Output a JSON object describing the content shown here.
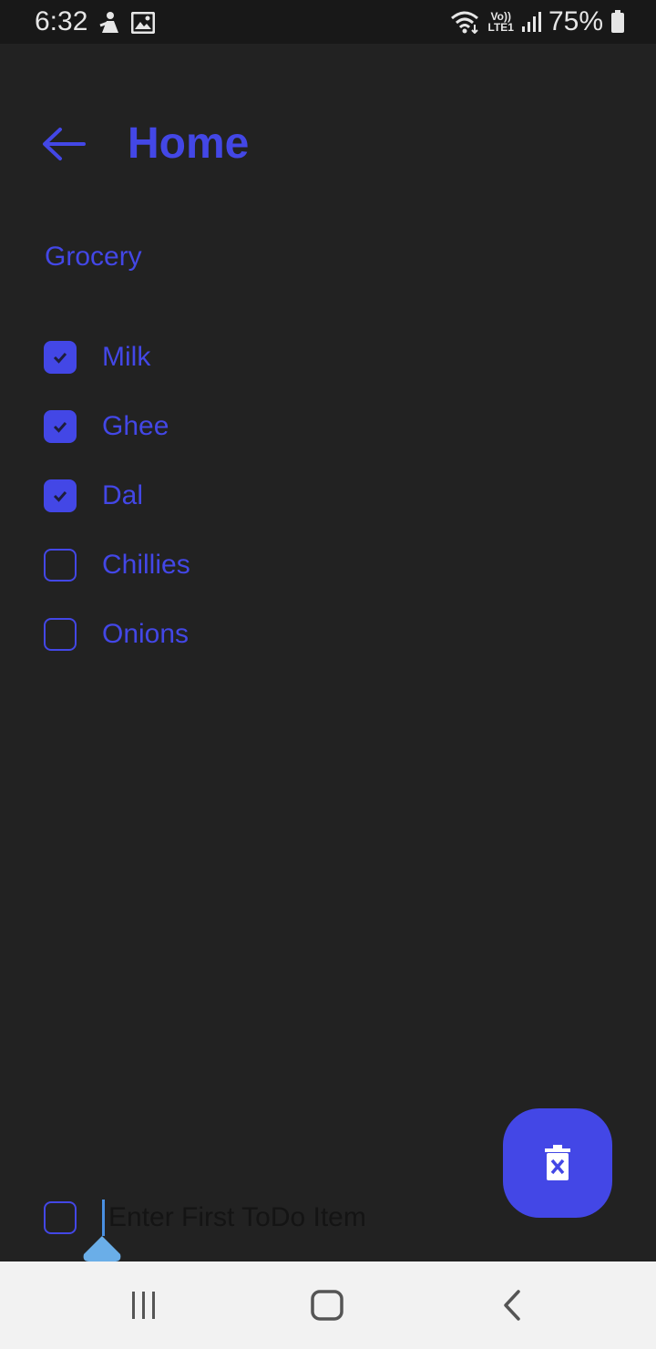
{
  "status_bar": {
    "time": "6:32",
    "battery": "75%",
    "network_label_top": "Vo))",
    "network_label_bottom": "LTE1",
    "icons": [
      "notification-app-icon",
      "image-icon",
      "wifi-icon",
      "signal-icon",
      "battery-icon"
    ]
  },
  "header": {
    "title": "Home",
    "back_icon": "back-arrow-icon"
  },
  "list": {
    "title": "Grocery",
    "items": [
      {
        "label": "Milk",
        "checked": true
      },
      {
        "label": "Ghee",
        "checked": true
      },
      {
        "label": "Dal",
        "checked": true
      },
      {
        "label": "Chillies",
        "checked": false
      },
      {
        "label": "Onions",
        "checked": false
      }
    ]
  },
  "new_item": {
    "placeholder": "Enter First ToDo Item",
    "value": ""
  },
  "fab": {
    "icon": "delete-bin-icon"
  },
  "nav_bar": {
    "icons": [
      "recents-icon",
      "home-icon",
      "back-icon"
    ]
  },
  "colors": {
    "accent": "#4347e6",
    "background": "#222222",
    "status_bar": "#181818",
    "nav_bar": "#f2f2f2",
    "cursor": "#4a90e2"
  }
}
